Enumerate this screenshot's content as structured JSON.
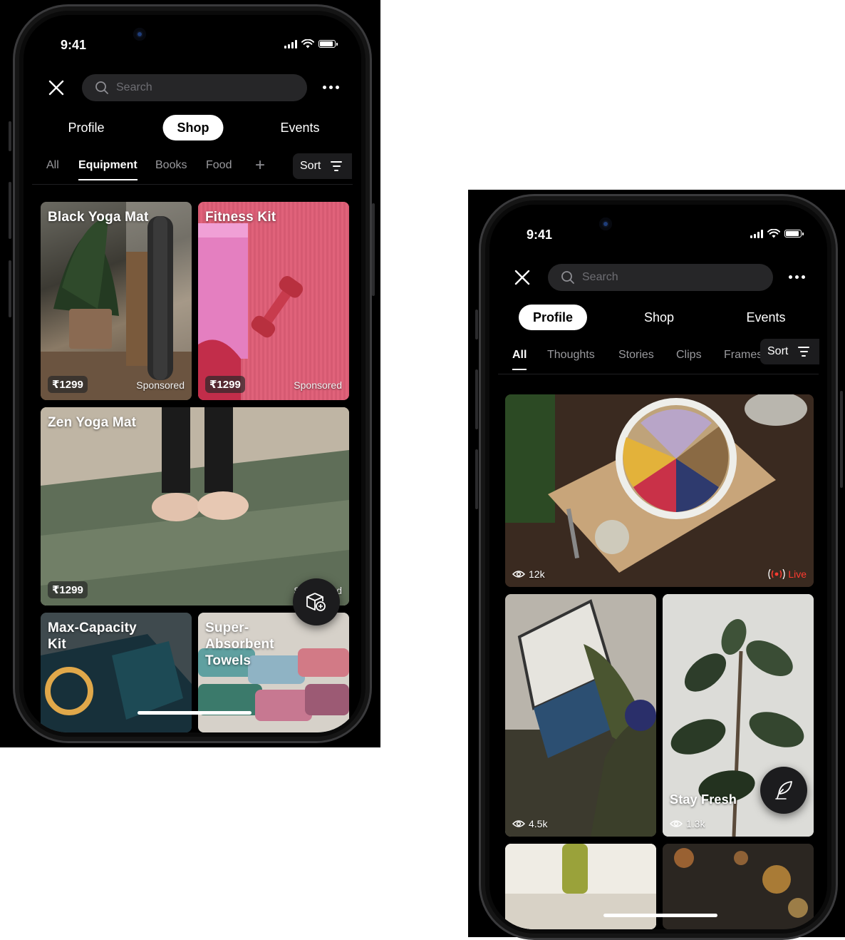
{
  "phone_left": {
    "status": {
      "time": "9:41"
    },
    "search": {
      "placeholder": "Search"
    },
    "segments": [
      "Profile",
      "Shop",
      "Events"
    ],
    "active_segment": "Shop",
    "subtabs": [
      "All",
      "Equipment",
      "Books",
      "Food"
    ],
    "active_subtab": "Equipment",
    "sort_label": "Sort",
    "cards": [
      {
        "title": "Black Yoga Mat",
        "price": "₹1299",
        "badge": "Sponsored"
      },
      {
        "title": "Fitness Kit",
        "price": "₹1299",
        "badge": "Sponsored"
      },
      {
        "title": "Zen Yoga Mat",
        "price": "₹1299",
        "badge": "Sponsored"
      },
      {
        "title": "Max-Capacity Kit"
      },
      {
        "title": "Super-Absorbent Towels"
      }
    ]
  },
  "phone_right": {
    "status": {
      "time": "9:41"
    },
    "search": {
      "placeholder": "Search"
    },
    "segments": [
      "Profile",
      "Shop",
      "Events"
    ],
    "active_segment": "Profile",
    "subtabs": [
      "All",
      "Thoughts",
      "Stories",
      "Clips",
      "Frames"
    ],
    "active_subtab": "All",
    "sort_label": "Sort",
    "posts": [
      {
        "views": "12k",
        "live": "Live"
      },
      {
        "views": "4.5k"
      },
      {
        "title": "Stay Fresh",
        "views": "1.3k"
      }
    ]
  },
  "colors": {
    "live": "#ff3b30",
    "background": "#000000",
    "search": "#262628"
  }
}
